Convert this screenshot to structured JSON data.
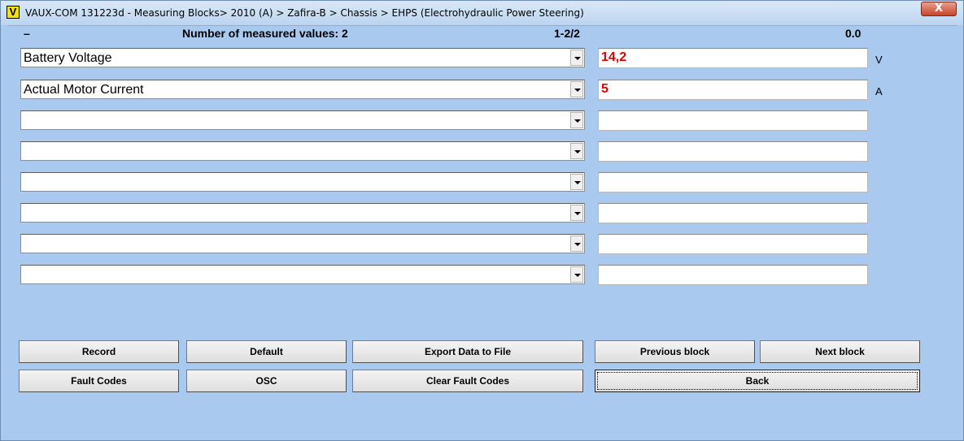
{
  "window": {
    "icon_letter": "V",
    "title": "VAUX-COM 131223d - Measuring Blocks> 2010 (A) > Zafira-B > Chassis > EHPS (Electrohydraulic Power Steering)",
    "close_label": "X"
  },
  "header": {
    "dash": "–",
    "count_label": "Number of measured values: 2",
    "page": "1-2/2",
    "value": "0.0"
  },
  "rows": [
    {
      "name": "Battery Voltage",
      "value": "14,2",
      "unit": "V"
    },
    {
      "name": "Actual Motor Current",
      "value": "5",
      "unit": "A"
    },
    {
      "name": "",
      "value": "",
      "unit": ""
    },
    {
      "name": "",
      "value": "",
      "unit": ""
    },
    {
      "name": "",
      "value": "",
      "unit": ""
    },
    {
      "name": "",
      "value": "",
      "unit": ""
    },
    {
      "name": "",
      "value": "",
      "unit": ""
    },
    {
      "name": "",
      "value": "",
      "unit": ""
    }
  ],
  "buttons": {
    "record": "Record",
    "default": "Default",
    "export": "Export Data to File",
    "previous": "Previous block",
    "next": "Next block",
    "fault_codes": "Fault Codes",
    "osc": "OSC",
    "clear_fault_codes": "Clear Fault Codes",
    "back": "Back"
  }
}
